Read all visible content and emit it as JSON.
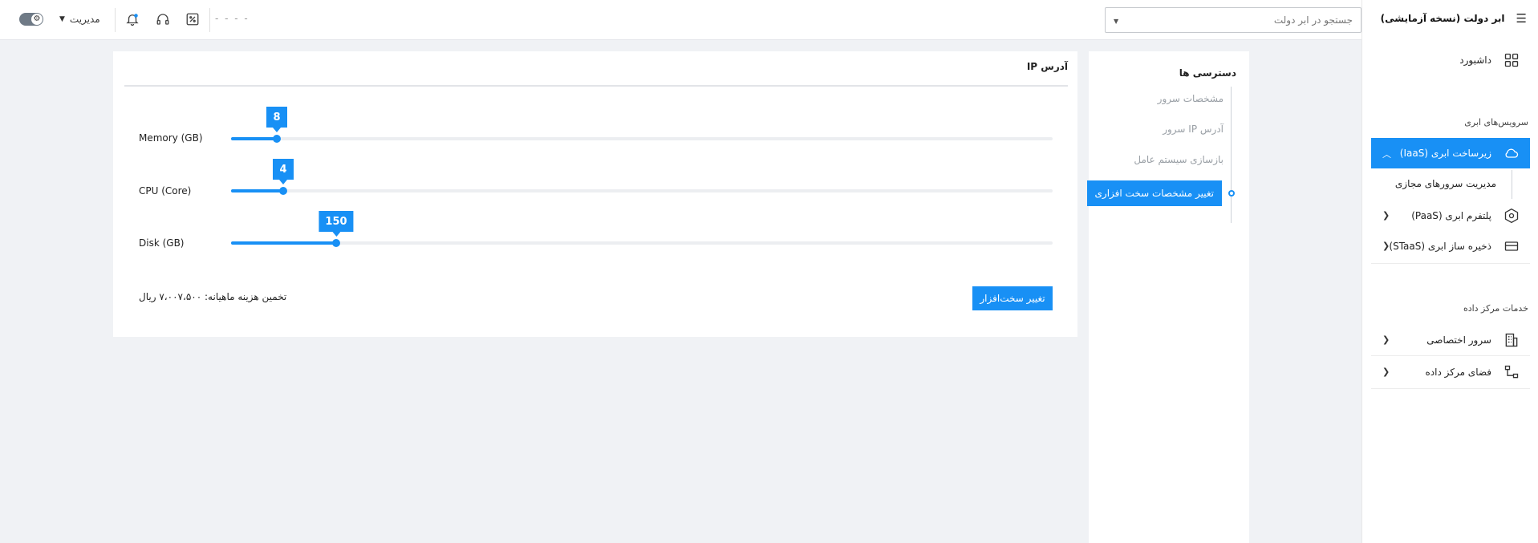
{
  "header": {
    "admin_label": "مدیریت",
    "dots": "- - - -",
    "search_placeholder": "جستجو در ابر دولت",
    "theme_icon": "gear-icon"
  },
  "sidebar": {
    "app_title": "ابر دولت (نسخه آزمایشی)",
    "dashboard": "داشبورد",
    "cloud_services_heading": "سرویس‌های ابری",
    "items": [
      {
        "label": "زیرساخت ابری (IaaS)",
        "icon": "cloud-icon",
        "active": true
      },
      {
        "label": "پلتفرم ابری (PaaS)",
        "icon": "hexagon-icon",
        "active": false
      },
      {
        "label": "ذخیره ساز ابری (STaaS)",
        "icon": "storage-icon",
        "active": false
      }
    ],
    "iaas_sub": "مدیریت سرورهای مجازی",
    "datacenter_heading": "خدمات مرکز داده",
    "dc_items": [
      {
        "label": "سرور اختصاصی",
        "icon": "building-icon"
      },
      {
        "label": "فضای مرکز داده",
        "icon": "network-icon"
      }
    ]
  },
  "access": {
    "title": "دسترسی ها",
    "items": [
      {
        "label": "مشخصات سرور",
        "active": false
      },
      {
        "label": "آدرس IP سرور",
        "active": false
      },
      {
        "label": "بازسازی سیستم عامل",
        "active": false
      },
      {
        "label": "تغییر مشخصات سخت افزاری",
        "active": true
      }
    ]
  },
  "card": {
    "title": "آدرس IP",
    "sliders": [
      {
        "label": "Memory (GB)",
        "value": "8",
        "fraction": 0.056
      },
      {
        "label": "CPU (Core)",
        "value": "4",
        "fraction": 0.063
      },
      {
        "label": "Disk (GB)",
        "value": "150",
        "fraction": 0.128
      }
    ],
    "cost": "تخمین هزینه ماهیانه: ۷،۰۰۷،۵۰۰ ریال",
    "button": "تغییر سخت‌افزار"
  },
  "colors": {
    "accent": "#1890f5",
    "background": "#f0f2f5"
  }
}
